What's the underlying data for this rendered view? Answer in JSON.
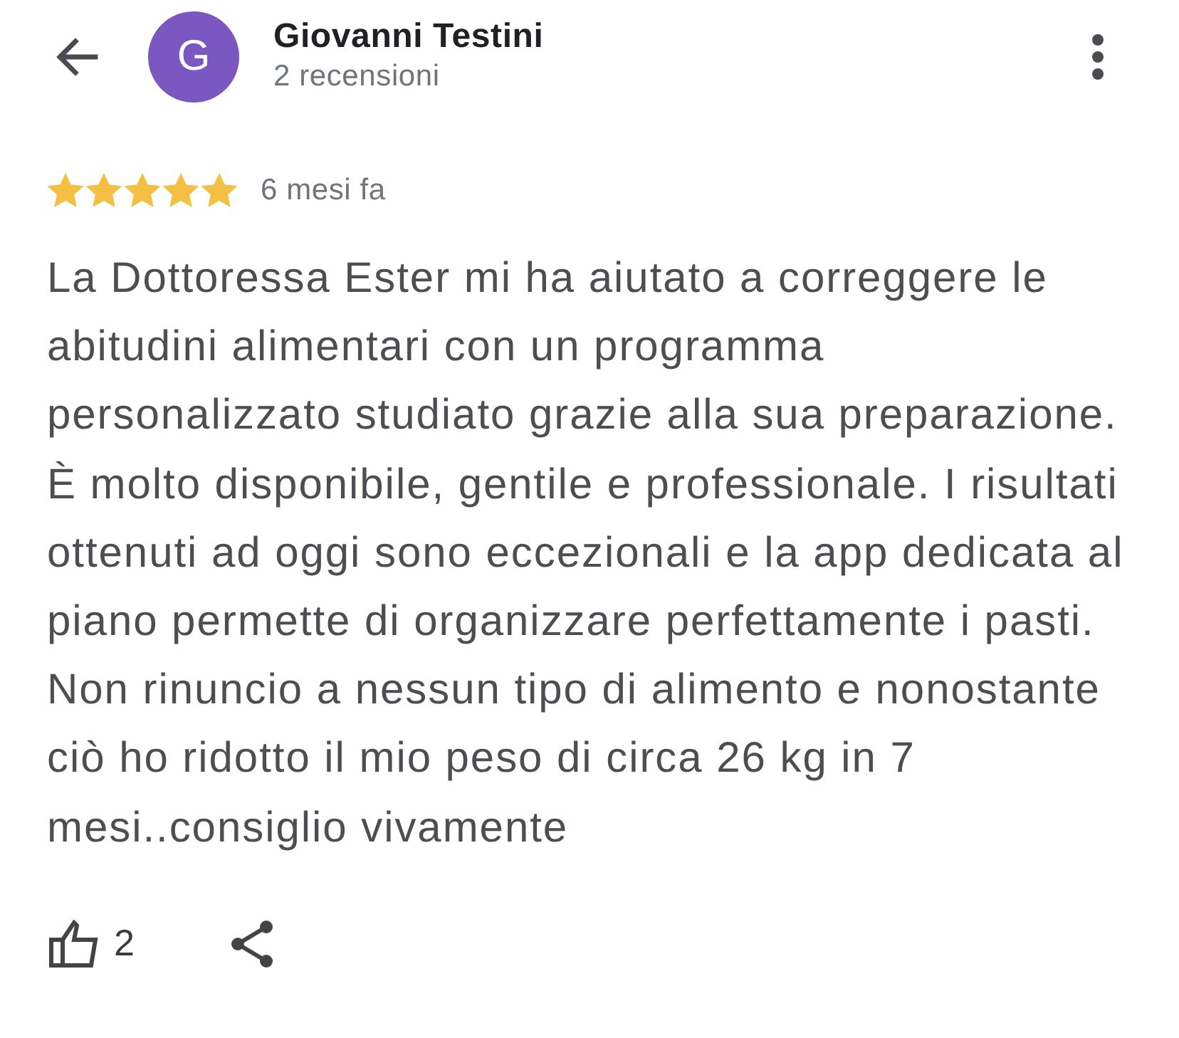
{
  "reviewer": {
    "initial": "G",
    "name": "Giovanni Testini",
    "review_count": "2 recensioni"
  },
  "review": {
    "stars": 5,
    "time": "6 mesi fa",
    "text": "La Dottoressa Ester mi ha aiutato a correggere le abitudini alimentari con un programma personalizzato studiato grazie alla sua preparazione. È molto disponibile, gentile e professionale. I risultati ottenuti ad oggi sono eccezionali e la app dedicata al piano permette di organizzare perfettamente i pasti. Non rinuncio a nessun tipo di alimento e nonostante ciò ho ridotto il mio peso di circa 26 kg in 7 mesi..consiglio vivamente"
  },
  "actions": {
    "likes": "2"
  }
}
